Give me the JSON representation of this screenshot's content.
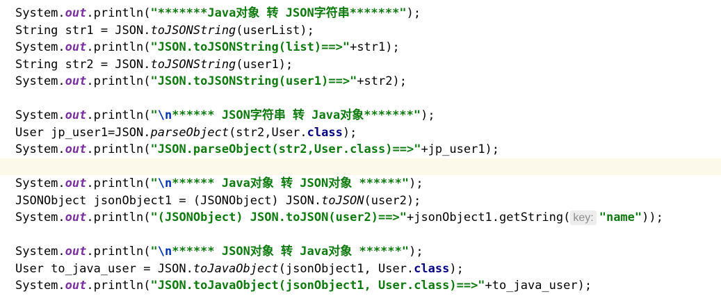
{
  "editor": {
    "lines": [
      [
        {
          "t": "System."
        },
        {
          "t": "out",
          "c": "field"
        },
        {
          "t": ".println("
        },
        {
          "t": "\"*******Java对象 转 JSON字符串*******\"",
          "c": "str"
        },
        {
          "t": ");"
        }
      ],
      [
        {
          "t": "String str1 = JSON."
        },
        {
          "t": "toJSONString",
          "c": "static"
        },
        {
          "t": "(userList);"
        }
      ],
      [
        {
          "t": "System."
        },
        {
          "t": "out",
          "c": "field"
        },
        {
          "t": ".println("
        },
        {
          "t": "\"JSON.toJSONString(list)==>\"",
          "c": "str"
        },
        {
          "t": "+str1);"
        }
      ],
      [
        {
          "t": "String str2 = JSON."
        },
        {
          "t": "toJSONString",
          "c": "static"
        },
        {
          "t": "(user1);"
        }
      ],
      [
        {
          "t": "System."
        },
        {
          "t": "out",
          "c": "field"
        },
        {
          "t": ".println("
        },
        {
          "t": "\"JSON.toJSONString(user1)==>\"",
          "c": "str"
        },
        {
          "t": "+str2);"
        }
      ],
      [],
      [
        {
          "t": "System."
        },
        {
          "t": "out",
          "c": "field"
        },
        {
          "t": ".println("
        },
        {
          "t": "\"",
          "c": "str"
        },
        {
          "t": "\\n",
          "c": "esc"
        },
        {
          "t": "****** JSON字符串 转 Java对象*******\"",
          "c": "str"
        },
        {
          "t": ");"
        }
      ],
      [
        {
          "t": "User jp_user1=JSON."
        },
        {
          "t": "parseObject",
          "c": "static"
        },
        {
          "t": "(str2,User."
        },
        {
          "t": "class",
          "c": "kw"
        },
        {
          "t": ");"
        }
      ],
      [
        {
          "t": "System."
        },
        {
          "t": "out",
          "c": "field"
        },
        {
          "t": ".println("
        },
        {
          "t": "\"JSON.parseObject(str2,User.class)==>\"",
          "c": "str"
        },
        {
          "t": "+jp_user1);"
        }
      ],
      [],
      [
        {
          "t": "System."
        },
        {
          "t": "out",
          "c": "field"
        },
        {
          "t": ".println("
        },
        {
          "t": "\"",
          "c": "str"
        },
        {
          "t": "\\n",
          "c": "esc"
        },
        {
          "t": "****** Java对象 转 JSON对象 ******\"",
          "c": "str"
        },
        {
          "t": ");"
        }
      ],
      [
        {
          "t": "JSONObject jsonObject1 = (JSONObject) JSON."
        },
        {
          "t": "toJSON",
          "c": "static"
        },
        {
          "t": "(user2);"
        }
      ],
      [
        {
          "t": "System."
        },
        {
          "t": "out",
          "c": "field"
        },
        {
          "t": ".println("
        },
        {
          "t": "\"(JSONObject) JSON.toJSON(user2)==>\"",
          "c": "str"
        },
        {
          "t": "+jsonObject1.getString("
        },
        {
          "t": "key:",
          "c": "hint"
        },
        {
          "t": "\"name\"",
          "c": "str"
        },
        {
          "t": "));"
        }
      ],
      [],
      [
        {
          "t": "System."
        },
        {
          "t": "out",
          "c": "field"
        },
        {
          "t": ".println("
        },
        {
          "t": "\"",
          "c": "str"
        },
        {
          "t": "\\n",
          "c": "esc"
        },
        {
          "t": "****** JSON对象 转 Java对象 ******\"",
          "c": "str"
        },
        {
          "t": ");"
        }
      ],
      [
        {
          "t": "User to_java_user = JSON."
        },
        {
          "t": "toJavaObject",
          "c": "static"
        },
        {
          "t": "(jsonObject1, User."
        },
        {
          "t": "class",
          "c": "kw"
        },
        {
          "t": ");"
        }
      ],
      [
        {
          "t": "System."
        },
        {
          "t": "out",
          "c": "field"
        },
        {
          "t": ".println("
        },
        {
          "t": "\"JSON.toJavaObject(jsonObject1, User.class)==>\"",
          "c": "str"
        },
        {
          "t": "+to_java_user);"
        }
      ]
    ],
    "current_line": 9,
    "colors": {
      "string": "#0d7a0d",
      "escape": "#0033b3",
      "field": "#7a2fa0",
      "keyword": "#000080",
      "current_line_bg": "#fdf9ea",
      "hint_bg": "#ededed"
    }
  }
}
